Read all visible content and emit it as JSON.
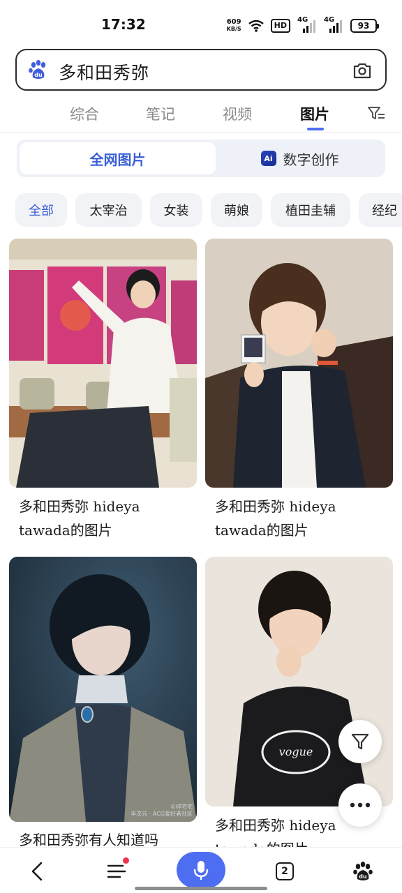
{
  "status_bar": {
    "time": "17:32",
    "net_speed_value": "609",
    "net_speed_unit": "KB/S",
    "hd_label": "HD",
    "signal1_label": "4G",
    "signal2_label": "4G",
    "battery": "93"
  },
  "search": {
    "query": "多和田秀弥",
    "left_icon": "baidu-paw-logo",
    "right_icon": "camera-icon"
  },
  "tabs": [
    {
      "label": "综合",
      "active": false
    },
    {
      "label": "笔记",
      "active": false
    },
    {
      "label": "视频",
      "active": false
    },
    {
      "label": "图片",
      "active": true
    }
  ],
  "segment": {
    "all_web_label": "全网图片",
    "ai_badge": "Ai",
    "digital_label": "数字创作"
  },
  "chips": [
    {
      "label": "全部",
      "active": true
    },
    {
      "label": "太宰治",
      "active": false
    },
    {
      "label": "女装",
      "active": false
    },
    {
      "label": "萌娘",
      "active": false
    },
    {
      "label": "植田圭辅",
      "active": false
    },
    {
      "label": "经纪",
      "active": false
    }
  ],
  "results": [
    {
      "caption_line1": "多和田秀弥 hideya",
      "caption_line2": "tawada的图片"
    },
    {
      "caption_line1": "多和田秀弥 hideya",
      "caption_line2": "tawada的图片"
    },
    {
      "caption_line1": "多和田秀弥有人知道吗",
      "caption_line2": ""
    },
    {
      "caption_line1": "多和田秀弥 hideya",
      "caption_line2": "tawada的图片"
    }
  ],
  "watermark": "©梓宅宅\n半次元 · ACG爱好者社区",
  "bottom_nav": {
    "tab_count": "2",
    "icons": [
      "back-icon",
      "menu-icon",
      "microphone-icon",
      "tabs-icon",
      "baidu-paw-icon"
    ]
  },
  "colors": {
    "accent": "#4e6ef2",
    "chip_bg": "#f2f3f6",
    "segment_bg": "#eef1f7",
    "active_text": "#3a5fd8",
    "notification": "#f0324b"
  }
}
